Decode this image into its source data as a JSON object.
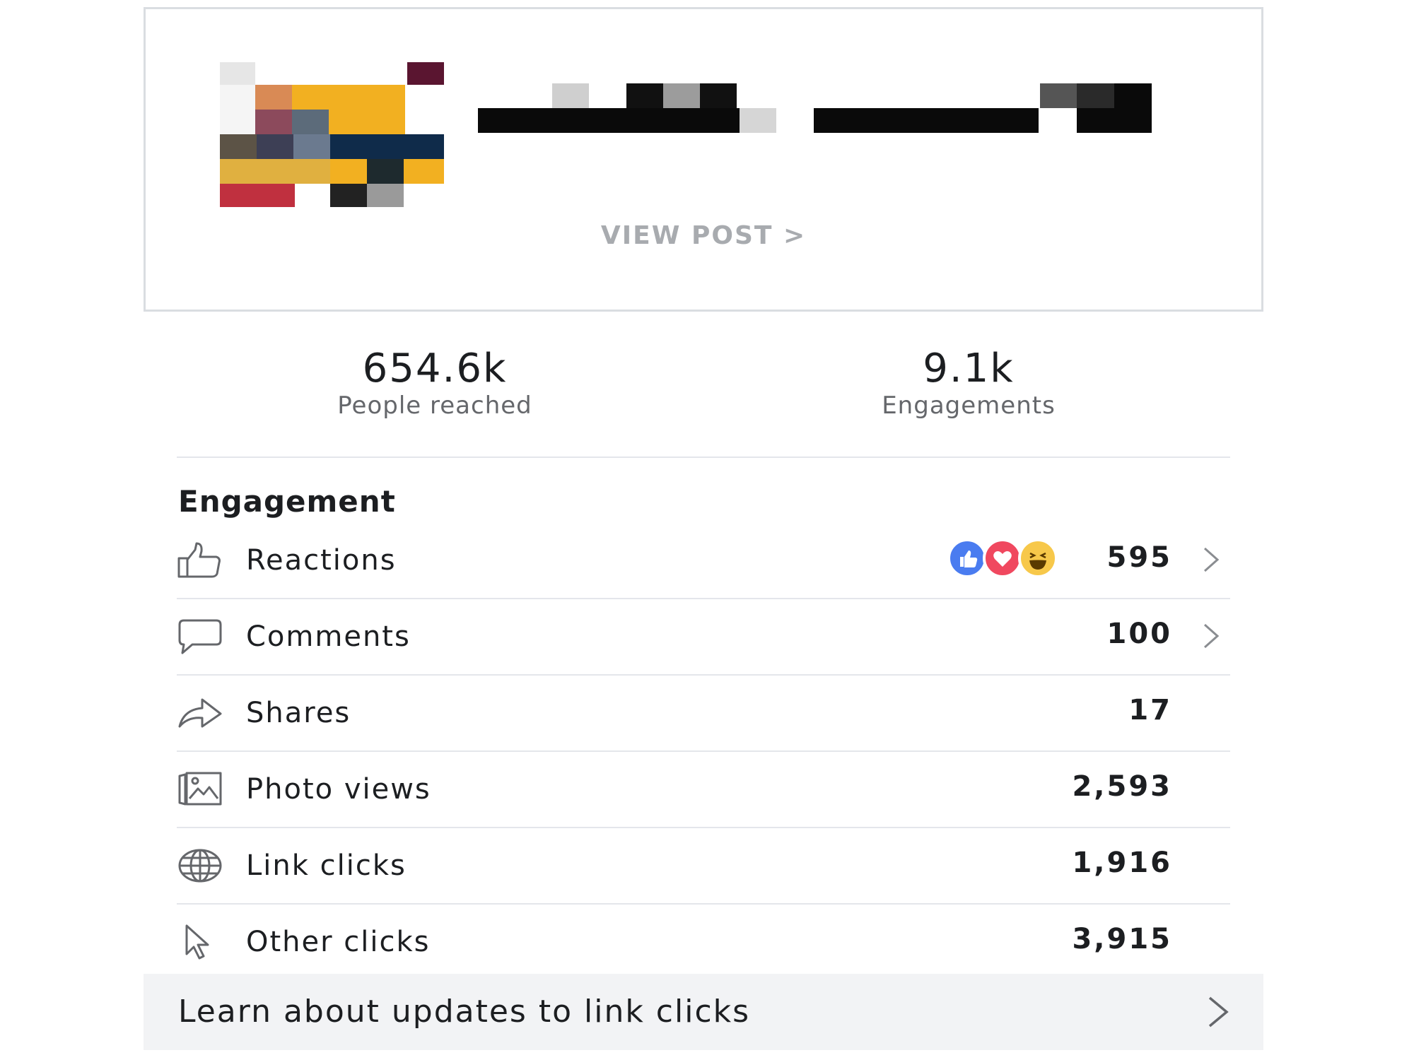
{
  "post": {
    "view_post_label": "VIEW POST >"
  },
  "summary": {
    "people_reached_value": "654.6k",
    "people_reached_label": "People reached",
    "engagements_value": "9.1k",
    "engagements_label": "Engagements"
  },
  "engagement": {
    "title": "Engagement",
    "rows": [
      {
        "label": "Reactions",
        "value": "595",
        "icon": "thumbs-up-icon",
        "has_chevron": true
      },
      {
        "label": "Comments",
        "value": "100",
        "icon": "comment-bubble-icon",
        "has_chevron": true
      },
      {
        "label": "Shares",
        "value": "17",
        "icon": "share-arrow-icon",
        "has_chevron": false
      },
      {
        "label": "Photo views",
        "value": "2,593",
        "icon": "photo-icon",
        "has_chevron": false
      },
      {
        "label": "Link clicks",
        "value": "1,916",
        "icon": "globe-icon",
        "has_chevron": false
      },
      {
        "label": "Other clicks",
        "value": "3,915",
        "icon": "cursor-icon",
        "has_chevron": false
      }
    ],
    "reaction_types": [
      "like",
      "love",
      "haha"
    ]
  },
  "learn_banner": {
    "text": "Learn about updates to link clicks"
  },
  "colors": {
    "like_blue": "#4a7cf0",
    "love_red": "#f0485f",
    "haha_yellow": "#f7c84a",
    "divider": "#e4e6eb",
    "banner_bg": "#f2f3f5"
  }
}
